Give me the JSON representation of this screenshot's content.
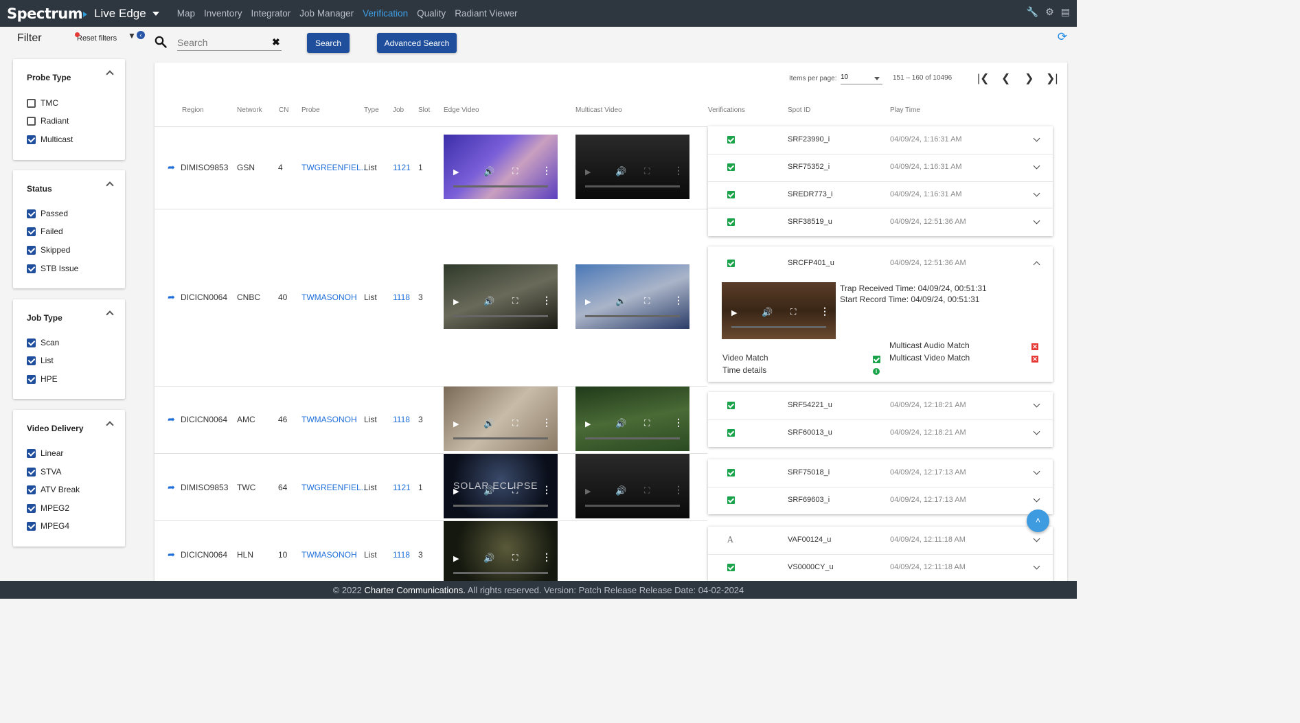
{
  "app": {
    "brand": "Spectrum",
    "name": "Live Edge",
    "nav": [
      "Map",
      "Inventory",
      "Integrator",
      "Job Manager",
      "Verification",
      "Quality",
      "Radiant Viewer"
    ],
    "active_nav": "Verification",
    "icons": [
      "wrench-icon",
      "gear-icon",
      "book-icon"
    ]
  },
  "filter": {
    "title": "Filter",
    "reset_label": "Reset filters",
    "sections": [
      {
        "title": "Probe Type",
        "items": [
          {
            "label": "TMC",
            "checked": false
          },
          {
            "label": "Radiant",
            "checked": false
          },
          {
            "label": "Multicast",
            "checked": true
          }
        ]
      },
      {
        "title": "Status",
        "items": [
          {
            "label": "Passed",
            "checked": true
          },
          {
            "label": "Failed",
            "checked": true
          },
          {
            "label": "Skipped",
            "checked": true
          },
          {
            "label": "STB Issue",
            "checked": true
          }
        ]
      },
      {
        "title": "Job Type",
        "items": [
          {
            "label": "Scan",
            "checked": true
          },
          {
            "label": "List",
            "checked": true
          },
          {
            "label": "HPE",
            "checked": true
          }
        ]
      },
      {
        "title": "Video Delivery",
        "items": [
          {
            "label": "Linear",
            "checked": true
          },
          {
            "label": "STVA",
            "checked": true
          },
          {
            "label": "ATV Break",
            "checked": true
          },
          {
            "label": "MPEG2",
            "checked": true
          },
          {
            "label": "MPEG4",
            "checked": true
          }
        ]
      }
    ]
  },
  "search": {
    "placeholder": "Search",
    "value": "",
    "search_label": "Search",
    "advanced_label": "Advanced Search"
  },
  "pager": {
    "items_per_page_label": "Items per page:",
    "items_per_page": "10",
    "range": "151 – 160 of 10496"
  },
  "columns": [
    "Region",
    "Network",
    "CN",
    "Probe",
    "Type",
    "Job",
    "Slot",
    "Edge Video",
    "Multicast Video",
    "Verifications",
    "Spot ID",
    "Play Time"
  ],
  "rows": [
    {
      "region": "DIMISO9853",
      "network": "GSN",
      "cn": "4",
      "probe": "TWGREENFIEL...",
      "type": "List",
      "job": "1121",
      "slot": "1",
      "verifications": [
        {
          "status": "passed",
          "spot": "SRF23990_i",
          "time": "04/09/24, 1:16:31 AM"
        },
        {
          "status": "passed",
          "spot": "SRF75352_i",
          "time": "04/09/24, 1:16:31 AM"
        },
        {
          "status": "passed",
          "spot": "SREDR773_i",
          "time": "04/09/24, 1:16:31 AM"
        }
      ]
    },
    {
      "region": "DICICN0064",
      "network": "CNBC",
      "cn": "40",
      "probe": "TWMASONOH",
      "type": "List",
      "job": "1118",
      "slot": "3",
      "verifications": [
        {
          "status": "passed",
          "spot": "SRF38519_u",
          "time": "04/09/24, 12:51:36 AM"
        },
        {
          "status": "passed",
          "spot": "SRCFP401_u",
          "time": "04/09/24, 12:51:36 AM"
        }
      ],
      "detail": {
        "trap_received": "Trap Received Time: 04/09/24, 00:51:31",
        "start_record": "Start Record Time: 04/09/24, 00:51:31",
        "video_match": "Video Match",
        "time_details": "Time details",
        "mc_audio": "Multicast Audio Match",
        "mc_video": "Multicast Video Match"
      }
    },
    {
      "region": "DICICN0064",
      "network": "AMC",
      "cn": "46",
      "probe": "TWMASONOH",
      "type": "List",
      "job": "1118",
      "slot": "3",
      "verifications": [
        {
          "status": "passed",
          "spot": "SRF54221_u",
          "time": "04/09/24, 12:18:21 AM"
        },
        {
          "status": "passed",
          "spot": "SRF60013_u",
          "time": "04/09/24, 12:18:21 AM"
        }
      ]
    },
    {
      "region": "DIMISO9853",
      "network": "TWC",
      "cn": "64",
      "probe": "TWGREENFIEL...",
      "type": "List",
      "job": "1121",
      "slot": "1",
      "edge_caption": "SOLAR ECLIPSE",
      "verifications": [
        {
          "status": "passed",
          "spot": "SRF75018_i",
          "time": "04/09/24, 12:17:13 AM"
        },
        {
          "status": "passed",
          "spot": "SRF69603_i",
          "time": "04/09/24, 12:17:13 AM"
        }
      ]
    },
    {
      "region": "DICICN0064",
      "network": "HLN",
      "cn": "10",
      "probe": "TWMASONOH",
      "type": "List",
      "job": "1118",
      "slot": "3",
      "verifications": [
        {
          "status": "audio",
          "spot": "VAF00124_u",
          "time": "04/09/24, 12:11:18 AM"
        },
        {
          "status": "passed",
          "spot": "VS0000CY_u",
          "time": "04/09/24, 12:11:18 AM"
        }
      ]
    }
  ],
  "footer": {
    "copyright": "© 2022",
    "company": "Charter Communications.",
    "rest": "All rights reserved. Version: Patch Release Release Date: 04-02-2024"
  }
}
